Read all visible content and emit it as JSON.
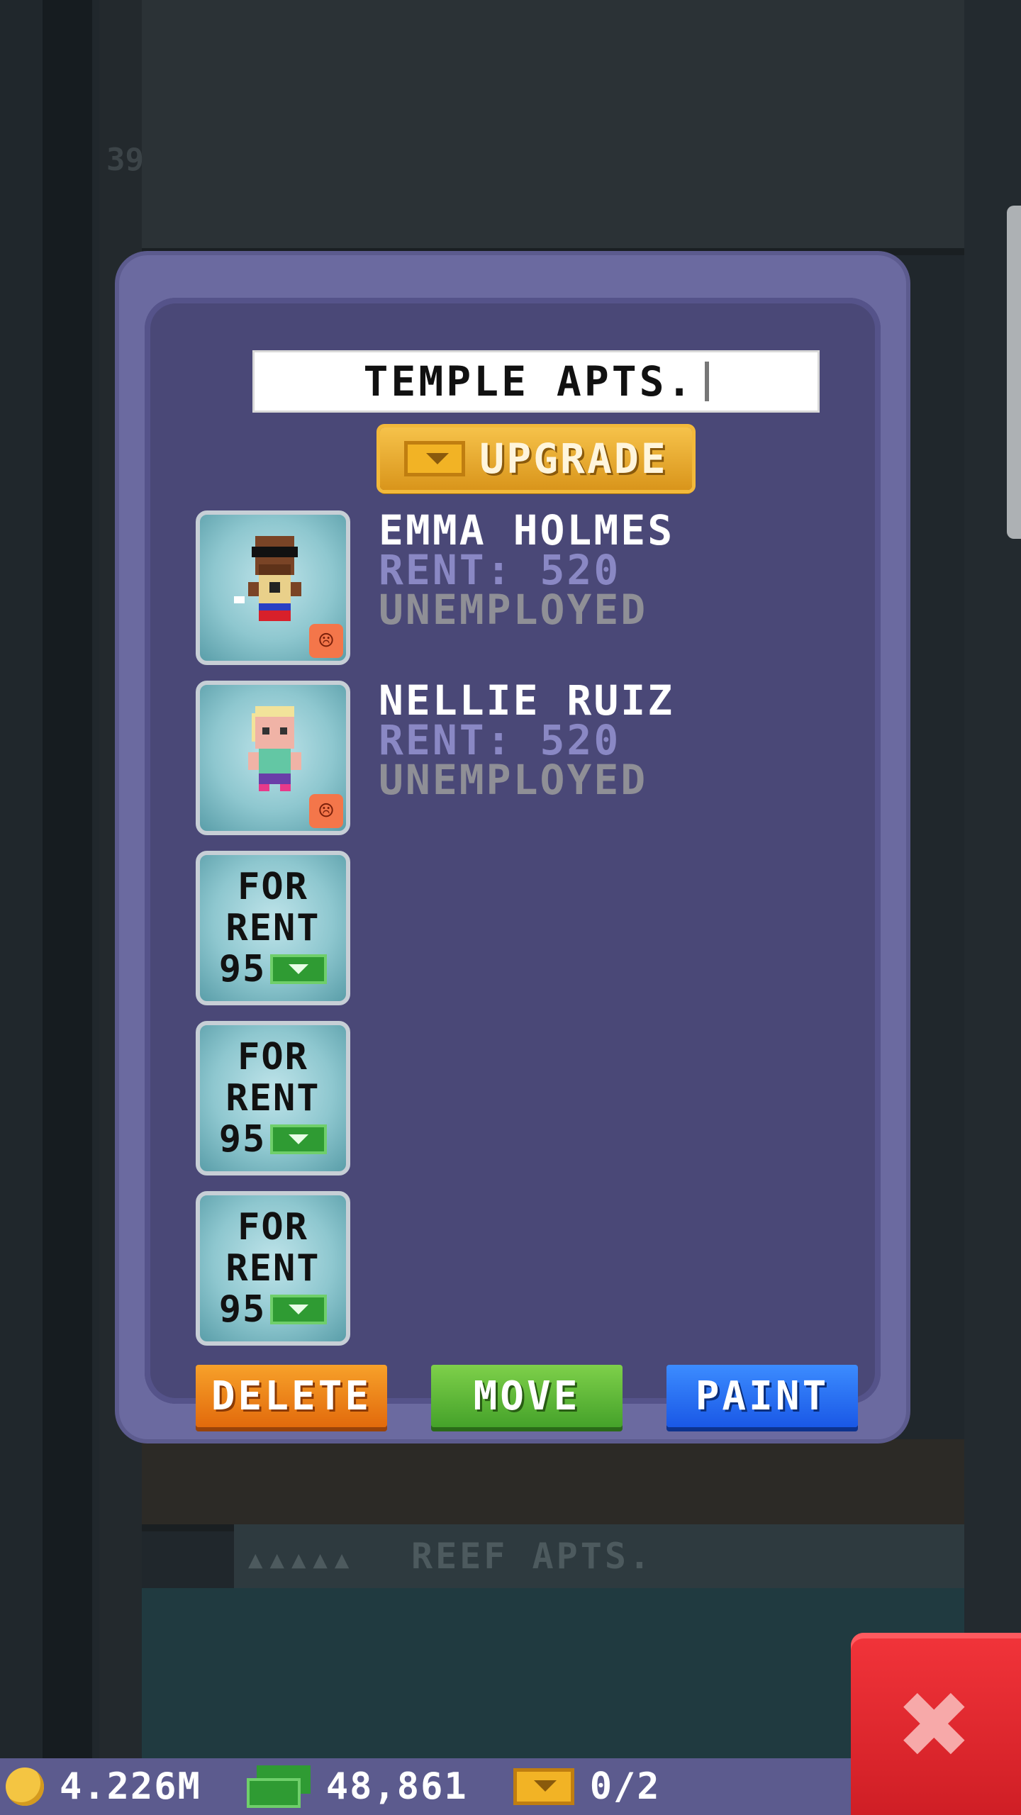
{
  "dialog": {
    "floor_name": "TEMPLE APTS.",
    "upgrade_label": "UPGRADE",
    "residents": [
      {
        "name": "EMMA HOLMES",
        "rent": "RENT: 520",
        "job": "UNEMPLOYED"
      },
      {
        "name": "NELLIE RUIZ",
        "rent": "RENT: 520",
        "job": "UNEMPLOYED"
      }
    ],
    "vacancies": [
      {
        "line1": "FOR",
        "line2": "RENT",
        "price": "95"
      },
      {
        "line1": "FOR",
        "line2": "RENT",
        "price": "95"
      },
      {
        "line1": "FOR",
        "line2": "RENT",
        "price": "95"
      }
    ],
    "actions": {
      "delete": "DELETE",
      "move": "MOVE",
      "paint": "PAINT"
    }
  },
  "background": {
    "floor_number": "39",
    "lower_floor_name": "REEF APTS."
  },
  "status": {
    "coins": "4.226M",
    "bux": "48,861",
    "tickets": "0/2"
  },
  "icons": {
    "upgrade": "golden-ticket-icon",
    "unhappy": "sad-face-icon",
    "rent_currency": "bux-icon",
    "coins": "coin-icon",
    "close": "close-x-icon"
  },
  "colors": {
    "dialog": "#6b6aa0",
    "delete": "#e26a0c",
    "move": "#45a22a",
    "paint": "#1a58e6",
    "close": "#cf1e25"
  }
}
